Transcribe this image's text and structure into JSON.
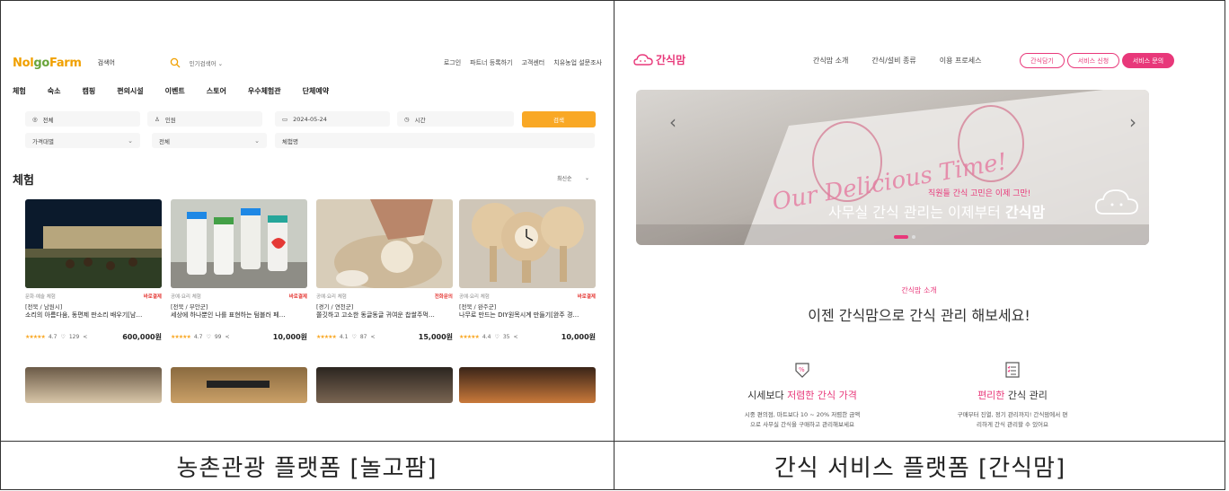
{
  "captions": {
    "left": "농촌관광 플랫폼 [놀고팜]",
    "right": "간식 서비스 플랫폼 [간식맘]"
  },
  "nolgo": {
    "logo": {
      "prefix": "Nol",
      "mid": "go",
      "suffix": "Farm"
    },
    "search_value": "검색어",
    "popular": "인기검색어",
    "util": [
      "로그인",
      "파트너 등록하기",
      "고객센터",
      "치유농업 설문조사"
    ],
    "nav": [
      "체험",
      "숙소",
      "캠핑",
      "편의시설",
      "이벤트",
      "스토어",
      "우수체험관",
      "단체예약"
    ],
    "filters": {
      "region": "전체",
      "people": "인원",
      "date": "2024-05-24",
      "time": "시간",
      "search_btn": "검색",
      "price": "가격대별",
      "category": "전체",
      "name": "체험명"
    },
    "section_title": "체험",
    "sort": "최신순",
    "cards": [
      {
        "cat": "문화·예술 체험",
        "badge": "바로결제",
        "loc": "[전북 / 남원시]",
        "title": "소리의 아름다움, 동편제 판소리 배우기[남…",
        "rating": "4.7",
        "likes": "129",
        "price": "600,000원"
      },
      {
        "cat": "공예·요리 체험",
        "badge": "바로결제",
        "loc": "[전북 / 부안군]",
        "title": "세상에 하나뿐인 나를 표현하는 텀블러 페…",
        "rating": "4.7",
        "likes": "99",
        "price": "10,000원"
      },
      {
        "cat": "공예·요리 체험",
        "badge": "전화문의",
        "loc": "[경기 / 연천군]",
        "title": "쫄깃하고 고소한 동글동글 귀여운 찹쌀주먹…",
        "rating": "4.1",
        "likes": "87",
        "price": "15,000원"
      },
      {
        "cat": "공예·요리 체험",
        "badge": "바로결제",
        "loc": "[전북 / 완주군]",
        "title": "나무로 만드는 DIY원목시계 만들기[완주 경…",
        "rating": "4.4",
        "likes": "35",
        "price": "10,000원"
      }
    ]
  },
  "ganshik": {
    "logo": "간식맘",
    "nav": [
      "간식맘 소개",
      "간식/설비 종류",
      "이용 프로세스"
    ],
    "pills": [
      "간식담기",
      "서비스 신청",
      "서비스 문의"
    ],
    "hero_script": "Our Delicious Time!",
    "hero_small": "직원들 간식 고민은 이제 그만!",
    "hero_main": "사무실 간식 관리는 이제부터",
    "hero_brand": "간식맘",
    "intro_label": "간식맘 소개",
    "intro_title": "이젠 간식맘으로 간식 관리 해보세요!",
    "feature1": {
      "pre": "시세보다 ",
      "hl": "저렴한 간식 가격",
      "post": "",
      "desc1": "시중 편의점, 마트보다 10 ~ 20% 저렴한 금액",
      "desc2": "으로 사무실 간식을 구매하고 관리해보세요"
    },
    "feature2": {
      "pre": "",
      "hl": "편리한",
      "post": " 간식 관리",
      "desc1": "구매부터 진열, 정기 관리까지! 간식맘에서 편",
      "desc2": "리하게 간식 관리할 수 있어요"
    },
    "colors": {
      "accent": "#e8387a",
      "orange": "#f9a825"
    }
  }
}
